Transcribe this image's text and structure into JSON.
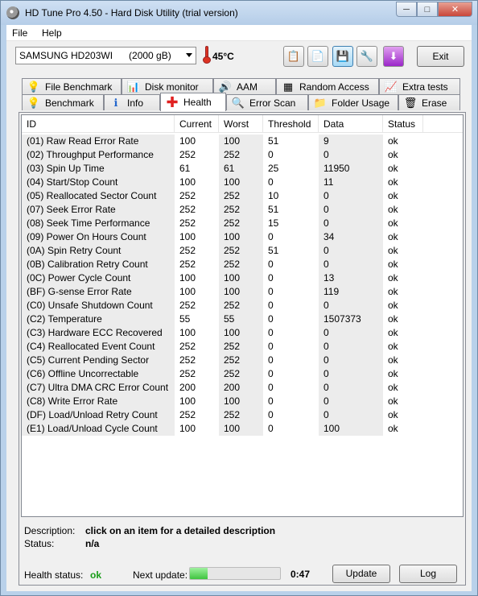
{
  "window": {
    "title": "HD Tune Pro 4.50 - Hard Disk Utility (trial version)"
  },
  "menu": {
    "file": "File",
    "help": "Help"
  },
  "toolbar": {
    "drive": "SAMSUNG HD203WI      (2000 gB)",
    "temperature": "45°C",
    "exit_label": "Exit"
  },
  "tabs_top": [
    {
      "label": "File Benchmark",
      "icon": "file-benchmark-icon"
    },
    {
      "label": "Disk monitor",
      "icon": "disk-monitor-icon"
    },
    {
      "label": "AAM",
      "icon": "speaker-icon"
    },
    {
      "label": "Random Access",
      "icon": "random-access-icon"
    },
    {
      "label": "Extra tests",
      "icon": "extra-tests-icon"
    }
  ],
  "tabs_bottom": [
    {
      "label": "Benchmark",
      "icon": "lightbulb-icon"
    },
    {
      "label": "Info",
      "icon": "info-icon"
    },
    {
      "label": "Health",
      "icon": "health-cross-icon"
    },
    {
      "label": "Error Scan",
      "icon": "magnifier-icon"
    },
    {
      "label": "Folder Usage",
      "icon": "folder-icon"
    },
    {
      "label": "Erase",
      "icon": "trash-icon"
    }
  ],
  "table": {
    "headers": [
      "ID",
      "Current",
      "Worst",
      "Threshold",
      "Data",
      "Status"
    ],
    "rows": [
      [
        "(01) Raw Read Error Rate",
        "100",
        "100",
        "51",
        "9",
        "ok"
      ],
      [
        "(02) Throughput Performance",
        "252",
        "252",
        "0",
        "0",
        "ok"
      ],
      [
        "(03) Spin Up Time",
        "61",
        "61",
        "25",
        "11950",
        "ok"
      ],
      [
        "(04) Start/Stop Count",
        "100",
        "100",
        "0",
        "11",
        "ok"
      ],
      [
        "(05) Reallocated Sector Count",
        "252",
        "252",
        "10",
        "0",
        "ok"
      ],
      [
        "(07) Seek Error Rate",
        "252",
        "252",
        "51",
        "0",
        "ok"
      ],
      [
        "(08) Seek Time Performance",
        "252",
        "252",
        "15",
        "0",
        "ok"
      ],
      [
        "(09) Power On Hours Count",
        "100",
        "100",
        "0",
        "34",
        "ok"
      ],
      [
        "(0A) Spin Retry Count",
        "252",
        "252",
        "51",
        "0",
        "ok"
      ],
      [
        "(0B) Calibration Retry Count",
        "252",
        "252",
        "0",
        "0",
        "ok"
      ],
      [
        "(0C) Power Cycle Count",
        "100",
        "100",
        "0",
        "13",
        "ok"
      ],
      [
        "(BF) G-sense Error Rate",
        "100",
        "100",
        "0",
        "119",
        "ok"
      ],
      [
        "(C0) Unsafe Shutdown Count",
        "252",
        "252",
        "0",
        "0",
        "ok"
      ],
      [
        "(C2) Temperature",
        "55",
        "55",
        "0",
        "1507373",
        "ok"
      ],
      [
        "(C3) Hardware ECC Recovered",
        "100",
        "100",
        "0",
        "0",
        "ok"
      ],
      [
        "(C4) Reallocated Event Count",
        "252",
        "252",
        "0",
        "0",
        "ok"
      ],
      [
        "(C5) Current Pending Sector",
        "252",
        "252",
        "0",
        "0",
        "ok"
      ],
      [
        "(C6) Offline Uncorrectable",
        "252",
        "252",
        "0",
        "0",
        "ok"
      ],
      [
        "(C7) Ultra DMA CRC Error Count",
        "200",
        "200",
        "0",
        "0",
        "ok"
      ],
      [
        "(C8) Write Error Rate",
        "100",
        "100",
        "0",
        "0",
        "ok"
      ],
      [
        "(DF) Load/Unload Retry Count",
        "252",
        "252",
        "0",
        "0",
        "ok"
      ],
      [
        "(E1) Load/Unload Cycle Count",
        "100",
        "100",
        "0",
        "100",
        "ok"
      ]
    ]
  },
  "details": {
    "description_label": "Description:",
    "description_value": "click on an item for a detailed description",
    "status_label": "Status:",
    "status_value": "n/a"
  },
  "footer": {
    "health_label": "Health status:",
    "health_value": "ok",
    "next_update_label": "Next update:",
    "next_update_progress": 0.2,
    "countdown": "0:47",
    "update_label": "Update",
    "log_label": "Log"
  },
  "colors": {
    "ok_green": "#1a9d1a",
    "progress_green": "#3fc43f",
    "titlebar": "#b9d1ea"
  }
}
